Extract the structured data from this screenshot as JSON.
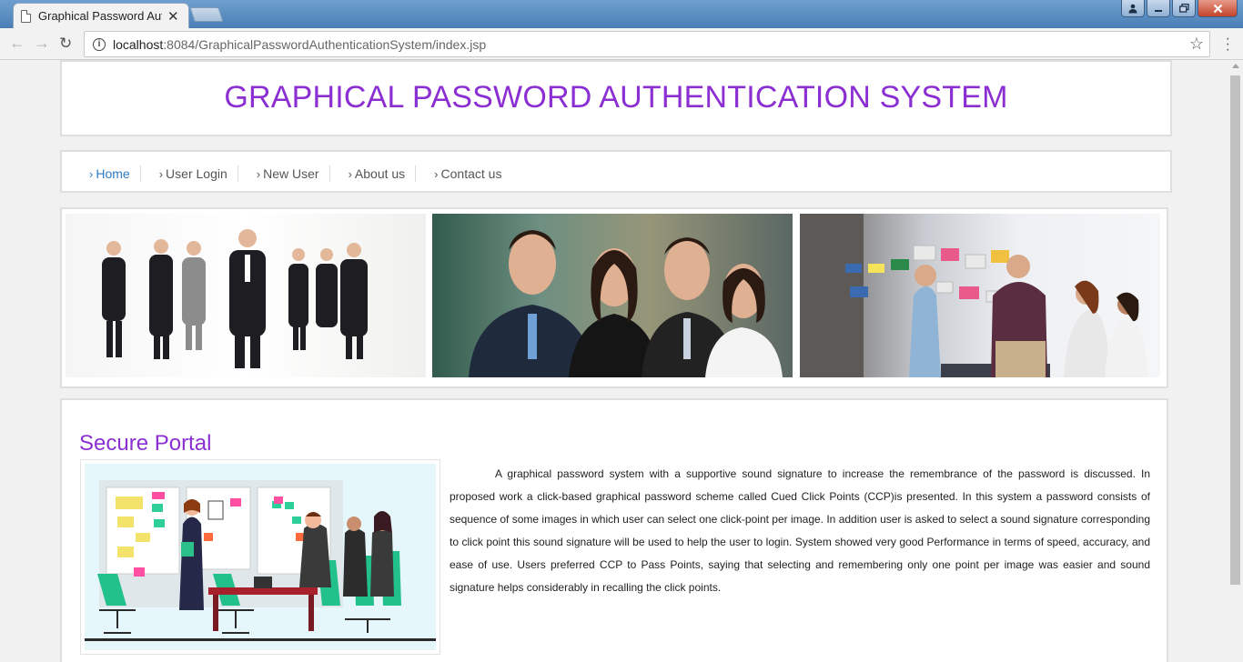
{
  "browser": {
    "tab_title": "Graphical Password Auth",
    "url_host": "localhost",
    "url_rest": ":8084/GraphicalPasswordAuthenticationSystem/index.jsp"
  },
  "icons": {
    "back": "arrow-left-icon",
    "forward": "arrow-right-icon",
    "reload": "reload-icon",
    "info": "info-icon",
    "bookmark": "star-icon",
    "menu": "more-vert-icon",
    "tab_doc": "document-icon",
    "tab_close": "close-icon"
  },
  "colors": {
    "title": "#8b2fd3",
    "nav_active": "#2e7bc4",
    "nav_text": "#555555"
  },
  "header": {
    "title": "GRAPHICAL PASSWORD AUTHENTICATION SYSTEM"
  },
  "nav": {
    "items": [
      {
        "label": "Home",
        "active": true
      },
      {
        "label": "User Login",
        "active": false
      },
      {
        "label": "New User",
        "active": false
      },
      {
        "label": "About us",
        "active": false
      },
      {
        "label": "Contact us",
        "active": false
      }
    ]
  },
  "content": {
    "section_title": "Secure Portal",
    "description": "A graphical password system with a supportive sound signature to increase the remembrance of the password is discussed. In proposed work a click-based graphical password scheme called Cued Click Points (CCP)is presented. In this system a password consists of sequence of some images in which user can select one click-point per image. In addition user is asked to select a sound signature corresponding to click point this sound signature will be used to help the user to login. System showed very good Performance in terms of speed, accuracy, and ease of use. Users preferred CCP to Pass Points, saying that selecting and remembering only one point per image was easier and sound signature helps considerably in recalling the click points."
  }
}
